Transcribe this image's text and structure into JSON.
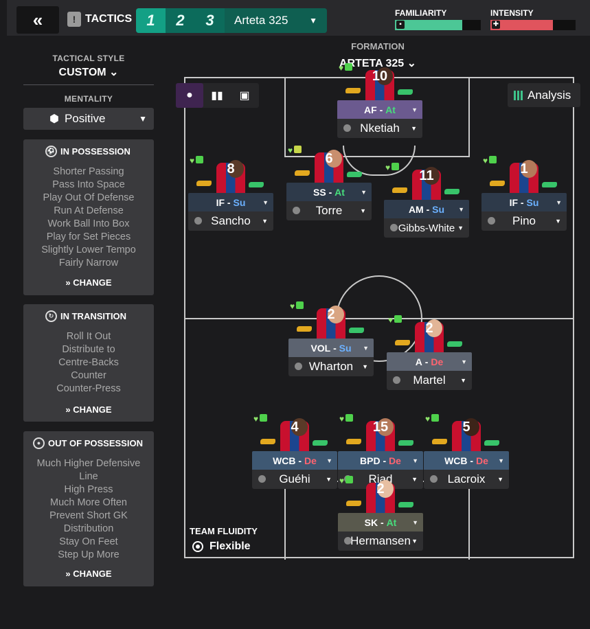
{
  "topbar": {
    "back_icon": "«",
    "tactics_icon": "!",
    "title": "TACTICS",
    "slots": [
      "1",
      "2",
      "3"
    ],
    "active_tactic": "Arteta 325",
    "familiarity_label": "FAMILIARITY",
    "familiarity_level": 0.78,
    "familiarity_icon": "▪",
    "intensity_label": "INTENSITY",
    "intensity_level": 0.73,
    "intensity_icon": "✚",
    "colors": {
      "familiarity": "#4cc796",
      "intensity": "#e0545d",
      "slot_active": "#13a085"
    }
  },
  "sidebar": {
    "style_label": "TACTICAL STYLE",
    "style_value": "CUSTOM ⌄",
    "mentality_label": "MENTALITY",
    "mentality_value": "Positive",
    "mentality_icon": "⬢",
    "in_possession": {
      "title": "IN POSSESSION",
      "items": [
        "Shorter Passing",
        "Pass Into Space",
        "Play Out Of Defense",
        "Run At Defense",
        "Work Ball Into Box",
        "Play for Set Pieces",
        "Slightly Lower Tempo",
        "Fairly Narrow"
      ],
      "change": "» CHANGE"
    },
    "in_transition": {
      "title": "IN TRANSITION",
      "items": [
        "Roll It Out",
        "Distribute to",
        "Centre-Backs",
        "Counter",
        "Counter-Press"
      ],
      "change": "» CHANGE"
    },
    "out_of_possession": {
      "title": "OUT OF POSSESSION",
      "items": [
        "Much Higher Defensive",
        "Line",
        "High Press",
        "Much More Often",
        "Prevent Short GK",
        "Distribution",
        "Stay On Feet",
        "Step Up More"
      ],
      "change": "» CHANGE"
    }
  },
  "pitch": {
    "formation_label": "FORMATION",
    "formation_value": "ARTETA 325 ⌄",
    "analysis_label": "Analysis",
    "fluidity_label": "TEAM FLUIDITY",
    "fluidity_value": "Flexible"
  },
  "players": [
    {
      "name": "Nketiah",
      "pos": "AF",
      "duty": "At",
      "duty_class": "at",
      "num": "10",
      "role_bg": "#6b5a8f"
    },
    {
      "name": "Sancho",
      "pos": "IF",
      "duty": "Su",
      "duty_class": "su",
      "num": "8",
      "role_bg": "#2e3a4a"
    },
    {
      "name": "Torre",
      "pos": "SS",
      "duty": "At",
      "duty_class": "at",
      "num": "6",
      "role_bg": "#2e3a4a"
    },
    {
      "name": "Gibbs-White",
      "pos": "AM",
      "duty": "Su",
      "duty_class": "su",
      "num": "11",
      "role_bg": "#2e3a4a"
    },
    {
      "name": "Pino",
      "pos": "IF",
      "duty": "Su",
      "duty_class": "su",
      "num": "1",
      "role_bg": "#2e3a4a"
    },
    {
      "name": "Wharton",
      "pos": "VOL",
      "duty": "Su",
      "duty_class": "su",
      "num": "2",
      "role_bg": "#5c6370"
    },
    {
      "name": "Martel",
      "pos": "A",
      "duty": "De",
      "duty_class": "de",
      "num": "2",
      "role_bg": "#5c6370"
    },
    {
      "name": "Guéhi",
      "pos": "WCB",
      "duty": "De",
      "duty_class": "de",
      "num": "4",
      "role_bg": "#3e5873"
    },
    {
      "name": "Riad",
      "pos": "BPD",
      "duty": "De",
      "duty_class": "de",
      "num": "15",
      "role_bg": "#3e5873"
    },
    {
      "name": "Lacroix",
      "pos": "WCB",
      "duty": "De",
      "duty_class": "de",
      "num": "5",
      "role_bg": "#3e5873"
    },
    {
      "name": "Hermansen",
      "pos": "SK",
      "duty": "At",
      "duty_class": "at",
      "num": "2",
      "role_bg": "#59594d"
    }
  ]
}
